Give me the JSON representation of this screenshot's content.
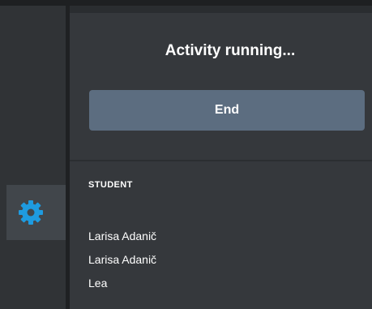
{
  "panel": {
    "title": "Activity running...",
    "end_button_label": "End"
  },
  "students": {
    "header": "STUDENT",
    "items": [
      {
        "name": "Larisa Adanič"
      },
      {
        "name": "Larisa Adanič"
      },
      {
        "name": "Lea"
      }
    ]
  },
  "sidebar": {
    "settings_icon": "gear-icon"
  },
  "colors": {
    "accent_icon": "#1e9be0",
    "button_bg": "#5c6d80",
    "panel_bg": "#35383c",
    "rail_bg": "#303336",
    "active_tile_bg": "#41464b"
  }
}
